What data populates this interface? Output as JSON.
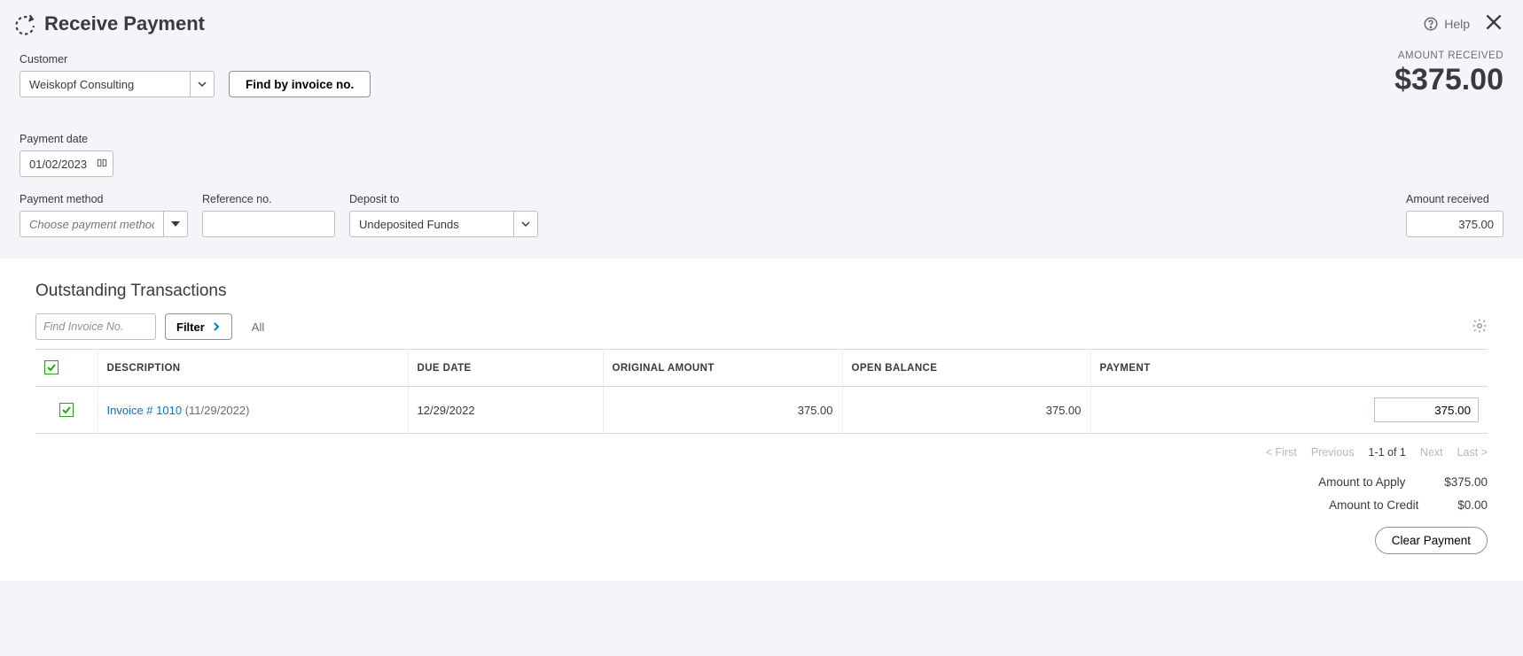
{
  "header": {
    "title": "Receive Payment",
    "help_label": "Help"
  },
  "customer": {
    "label": "Customer",
    "value": "Weiskopf Consulting",
    "find_button": "Find by invoice no."
  },
  "amount_received_header": {
    "label": "AMOUNT RECEIVED",
    "value": "$375.00"
  },
  "payment_date": {
    "label": "Payment date",
    "value": "01/02/2023"
  },
  "payment_method": {
    "label": "Payment method",
    "placeholder": "Choose payment method"
  },
  "reference": {
    "label": "Reference no.",
    "value": ""
  },
  "deposit": {
    "label": "Deposit to",
    "value": "Undeposited Funds"
  },
  "amount_received_field": {
    "label": "Amount received",
    "value": "375.00"
  },
  "transactions": {
    "title": "Outstanding Transactions",
    "find_placeholder": "Find Invoice No.",
    "filter_label": "Filter",
    "all_label": "All",
    "columns": {
      "description": "DESCRIPTION",
      "due_date": "DUE DATE",
      "original_amount": "ORIGINAL AMOUNT",
      "open_balance": "OPEN BALANCE",
      "payment": "PAYMENT"
    },
    "rows": [
      {
        "link_text": "Invoice # 1010",
        "date_suffix": " (11/29/2022)",
        "due_date": "12/29/2022",
        "original_amount": "375.00",
        "open_balance": "375.00",
        "payment": "375.00"
      }
    ]
  },
  "pager": {
    "first": "< First",
    "previous": "Previous",
    "range": "1-1 of 1",
    "next": "Next",
    "last": "Last >"
  },
  "totals": {
    "apply_label": "Amount to Apply",
    "apply_value": "$375.00",
    "credit_label": "Amount to Credit",
    "credit_value": "$0.00",
    "clear_button": "Clear Payment"
  }
}
